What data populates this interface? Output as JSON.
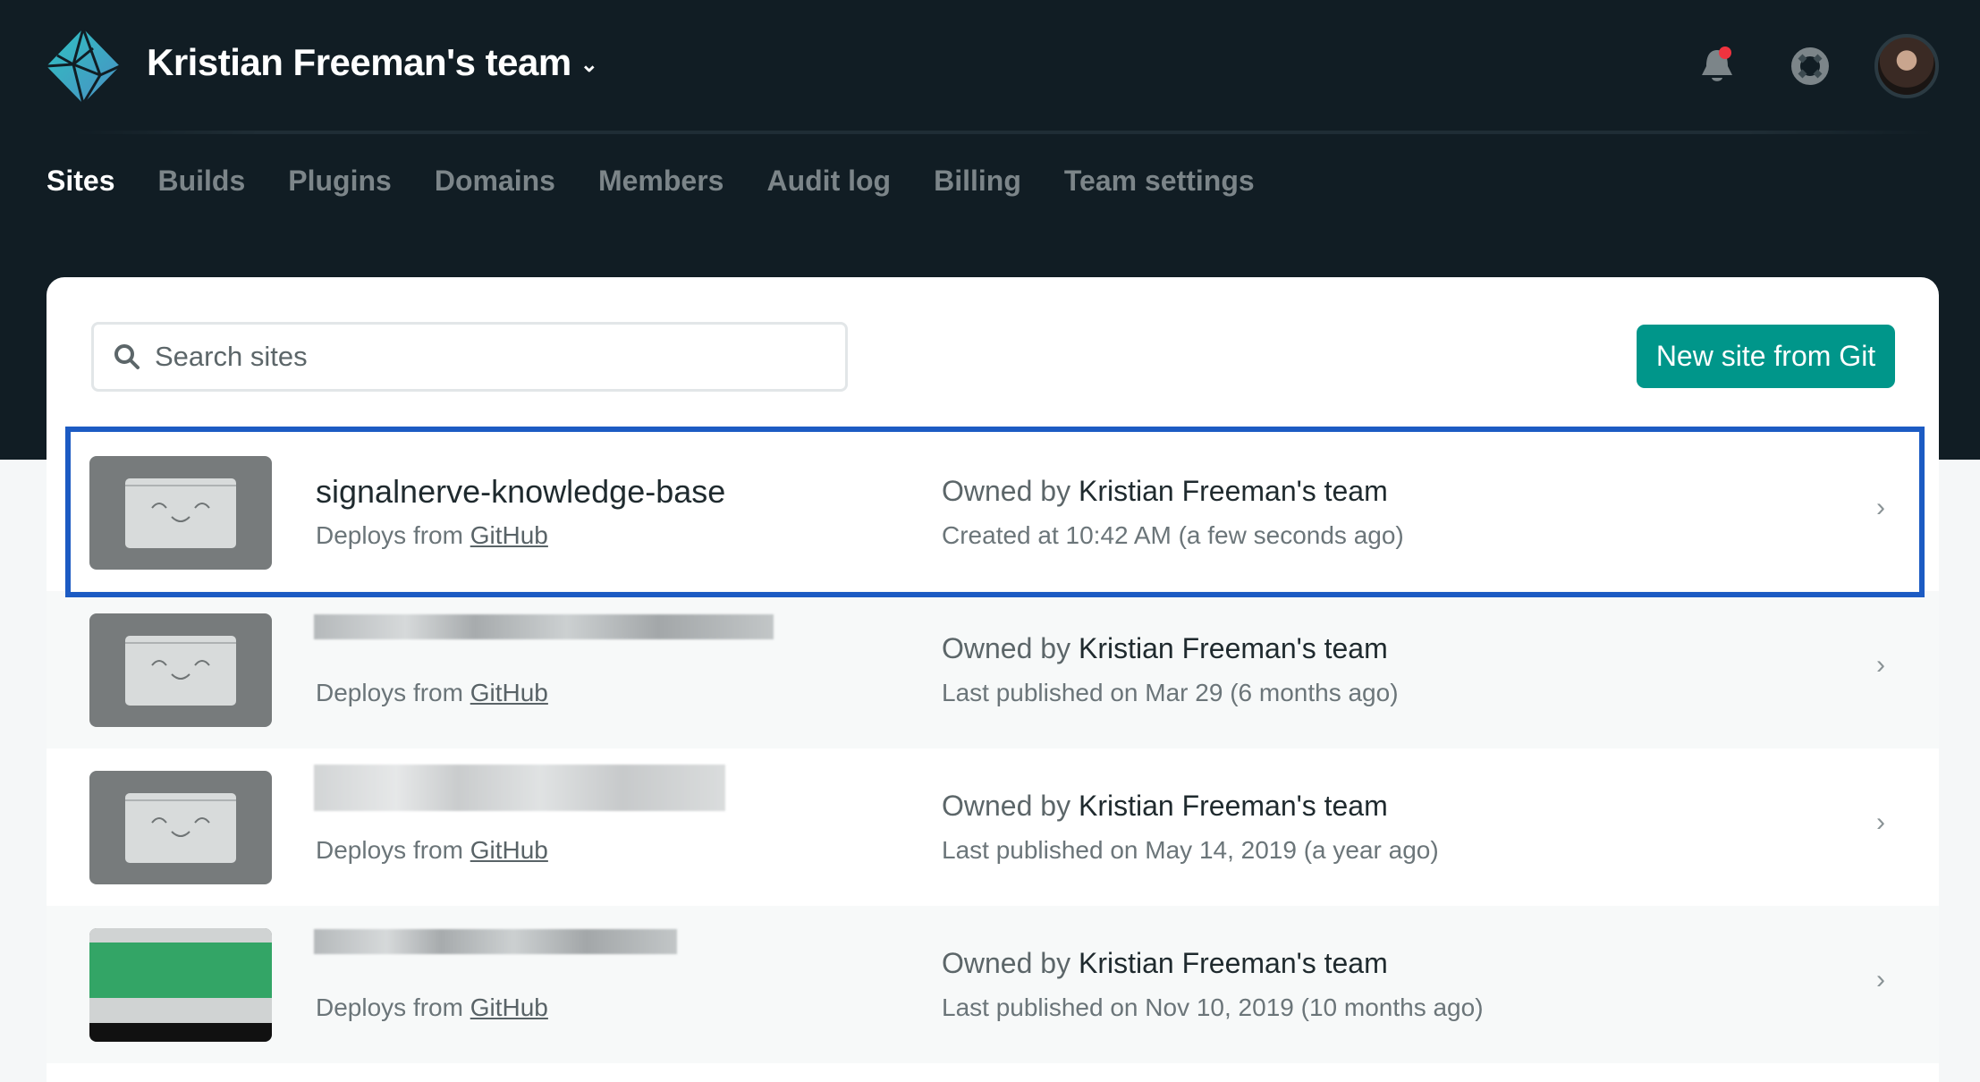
{
  "header": {
    "team_name": "Kristian Freeman's team",
    "notification_color": "#f0333f"
  },
  "nav": {
    "items": [
      {
        "label": "Sites",
        "active": true
      },
      {
        "label": "Builds"
      },
      {
        "label": "Plugins"
      },
      {
        "label": "Domains"
      },
      {
        "label": "Members"
      },
      {
        "label": "Audit log"
      },
      {
        "label": "Billing"
      },
      {
        "label": "Team settings"
      }
    ]
  },
  "search": {
    "placeholder": "Search sites"
  },
  "new_site_button": "New site from Git",
  "sites": [
    {
      "name": "signalnerve-knowledge-base",
      "deploys_prefix": "Deploys from ",
      "deploys_link": "GitHub",
      "owner_prefix": "Owned by ",
      "owner": "Kristian Freeman's team",
      "date": "Created at 10:42 AM (a few seconds ago)",
      "selected": true
    },
    {
      "deploys_prefix": "Deploys from ",
      "deploys_link": "GitHub",
      "owner_prefix": "Owned by ",
      "owner": "Kristian Freeman's team",
      "date": "Last published on Mar 29 (6 months ago)"
    },
    {
      "deploys_prefix": "Deploys from ",
      "deploys_link": "GitHub",
      "owner_prefix": "Owned by ",
      "owner": "Kristian Freeman's team",
      "date": "Last published on May 14, 2019 (a year ago)"
    },
    {
      "deploys_prefix": "Deploys from ",
      "deploys_link": "GitHub",
      "owner_prefix": "Owned by ",
      "owner": "Kristian Freeman's team",
      "date": "Last published on Nov 10, 2019 (10 months ago)"
    }
  ]
}
